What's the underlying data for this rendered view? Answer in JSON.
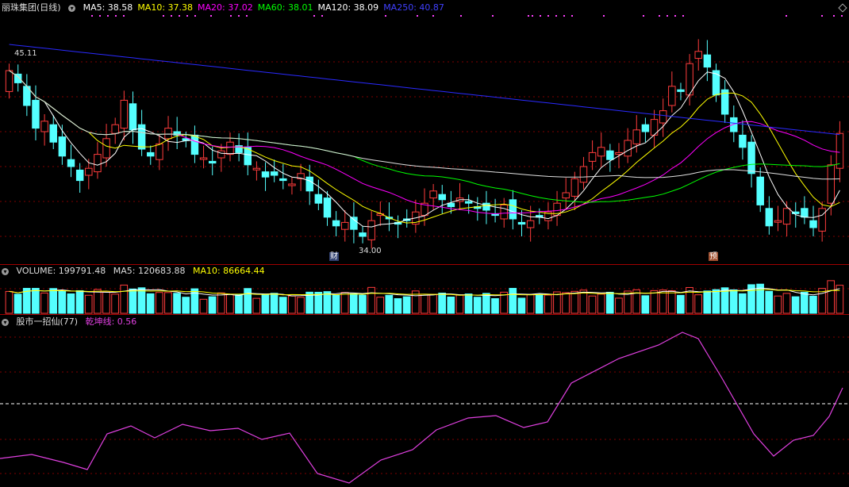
{
  "stock": {
    "name": "丽珠集团",
    "period": "(日线)"
  },
  "ma": [
    {
      "label": "MA5: 38.58",
      "color": "#ffffff"
    },
    {
      "label": "MA10: 37.38",
      "color": "#ffff00"
    },
    {
      "label": "MA20: 37.02",
      "color": "#ff00ff"
    },
    {
      "label": "MA60: 38.01",
      "color": "#00ff00"
    },
    {
      "label": "MA120: 38.09",
      "color": "#ffffff"
    },
    {
      "label": "MA250: 40.87",
      "color": "#4040ff"
    }
  ],
  "price": {
    "high_label": "45.11",
    "low_label": "34.00",
    "tag_cai": "财",
    "tag_yu": "预"
  },
  "volume": {
    "label": "VOLUME: 199791.48",
    "ma5": "MA5: 120683.88",
    "ma10": "MA10: 86664.44"
  },
  "indicator": {
    "name": "股市一招仙(77)",
    "line": "乾坤线: 0.56"
  },
  "colors": {
    "up": "#ff3c3c",
    "down": "#54ffff",
    "ma5": "#ffffff",
    "ma10": "#ffff00",
    "ma20": "#ff00ff",
    "ma60": "#00ff00",
    "ma120": "#e0e0e0",
    "ma250": "#2a2aff",
    "indicator": "#e040e0",
    "grid": "#800000"
  },
  "chart_data": {
    "type": "candlestick",
    "closes": [
      43.5,
      42.8,
      41.5,
      40.2,
      40.6,
      39.4,
      38.6,
      38.0,
      37.2,
      37.9,
      38.7,
      39.6,
      40.4,
      41.8,
      40.1,
      39.0,
      38.6,
      39.3,
      40.2,
      39.8,
      39.5,
      38.7,
      38.5,
      38.2,
      38.9,
      39.4,
      38.8,
      38.1,
      37.9,
      37.4,
      37.5,
      37.2,
      37.0,
      37.6,
      36.6,
      35.9,
      35.1,
      34.6,
      34.8,
      34.4,
      34.0,
      34.9,
      35.3,
      35.0,
      34.7,
      34.9,
      35.4,
      35.9,
      36.6,
      36.1,
      35.7,
      36.2,
      35.9,
      35.6,
      35.5,
      35.2,
      35.8,
      35.0,
      34.7,
      34.9,
      35.1,
      35.4,
      35.9,
      36.5,
      37.3,
      38.0,
      38.8,
      39.1,
      38.4,
      38.8,
      39.5,
      40.1,
      40.0,
      40.7,
      41.2,
      42.6,
      42.3,
      43.9,
      44.6,
      43.7,
      42.1,
      41.0,
      40.0,
      39.1,
      37.6,
      35.8,
      34.6,
      34.9,
      35.6,
      35.3,
      35.1,
      34.5,
      35.6,
      38.1,
      39.9
    ]
  }
}
